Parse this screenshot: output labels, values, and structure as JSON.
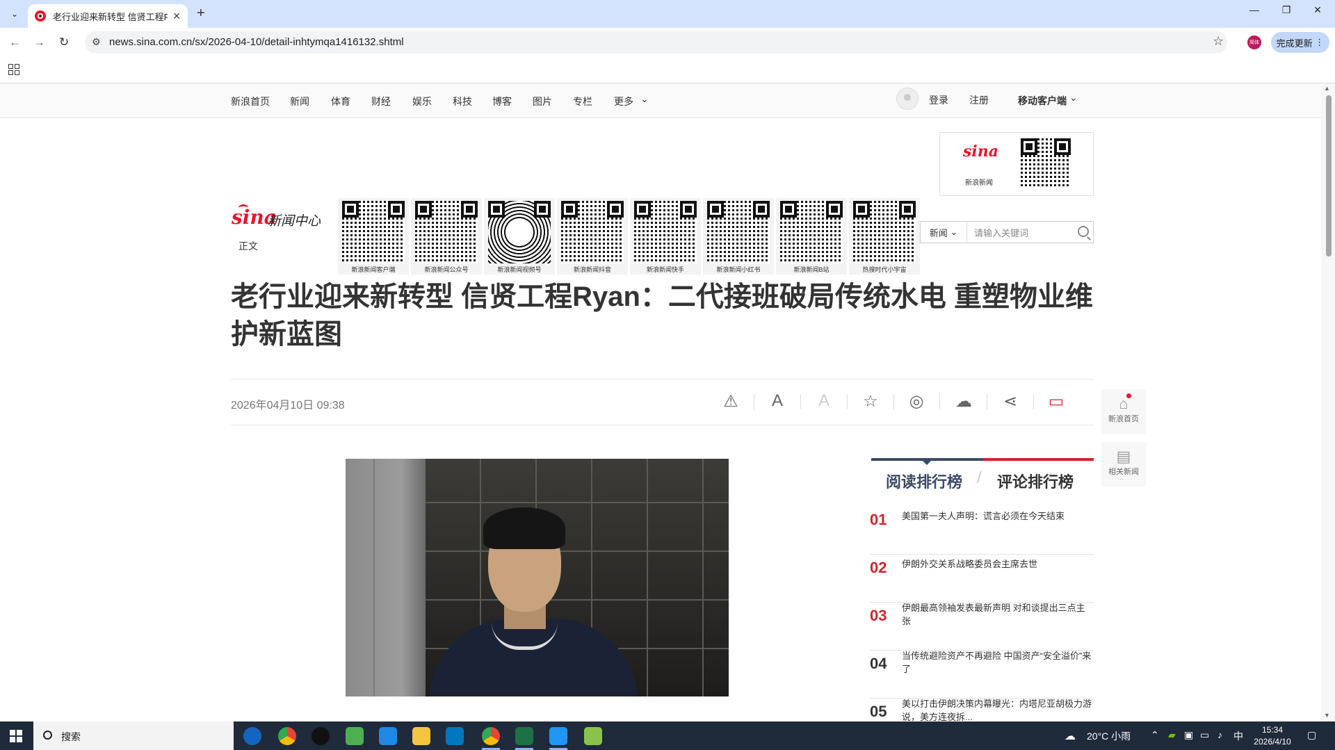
{
  "browser": {
    "tab_title": "老行业迎来新转型 信贤工程Ryan：二代接班破局传统水电 重塑物业维护新蓝图",
    "url": "news.sina.com.cn/sx/2026-04-10/detail-inhtymqa1416132.shtml",
    "profile_label": "简体",
    "update_label": "完成更新"
  },
  "sina_nav": {
    "items": [
      "新浪首页",
      "新闻",
      "体育",
      "财经",
      "娱乐",
      "科技",
      "博客",
      "图片",
      "专栏",
      "更多"
    ],
    "login": "登录",
    "register": "注册",
    "mobile": "移动客户端"
  },
  "qr_top": {
    "logo": "sina",
    "caption": "新浪新闻"
  },
  "header": {
    "logo": "sina",
    "logo_sub": "新闻中心",
    "section": "正文",
    "qr_captions": [
      "新浪新闻客户端",
      "新浪新闻公众号",
      "新浪新闻视频号",
      "新浪新闻抖音",
      "新浪新闻快手",
      "新浪新闻小红书",
      "新浪新闻B站",
      "热搜时代小宇宙"
    ]
  },
  "search": {
    "category": "新闻",
    "placeholder": "请输入关键词"
  },
  "article": {
    "title": "老行业迎来新转型 信贤工程Ryan：二代接班破局传统水电 重塑物业维护新蓝图",
    "date": "2026年04月10日 09:38"
  },
  "side_buttons": {
    "home": "新浪首页",
    "related": "相关新闻"
  },
  "rankings": {
    "tab_read": "阅读排行榜",
    "tab_comment": "评论排行榜",
    "items": [
      {
        "num": "01",
        "text": "美国第一夫人声明：谎言必须在今天结束"
      },
      {
        "num": "02",
        "text": "伊朗外交关系战略委员会主席去世"
      },
      {
        "num": "03",
        "text": "伊朗最高领袖发表最新声明 对和谈提出三点主张"
      },
      {
        "num": "04",
        "text": "当传统避险资产不再避险 中国资产“安全溢价”来了"
      },
      {
        "num": "05",
        "text": "美以打击伊朗决策内幕曝光：内塔尼亚胡极力游说，美方连夜拆..."
      }
    ]
  },
  "taskbar": {
    "search": "搜索",
    "weather": "20°C 小雨",
    "ime": "中",
    "time": "15:34",
    "date": "2026/4/10"
  }
}
